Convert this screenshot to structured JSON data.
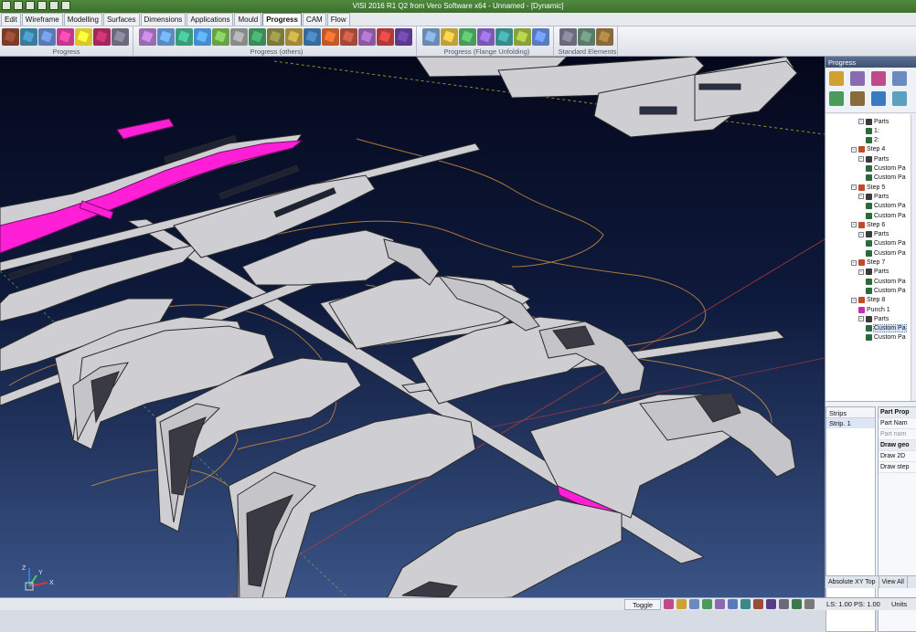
{
  "window": {
    "title": "VISI 2016 R1 Q2 from Vero Software x64 - Unnamed - [Dynamic]"
  },
  "menu": {
    "tabs": [
      "Edit",
      "Wireframe",
      "Modelling",
      "Surfaces",
      "Dimensions",
      "Applications",
      "Mould",
      "Progress",
      "CAM",
      "Flow"
    ],
    "active": "Progress"
  },
  "ribbon": {
    "groups": [
      {
        "label": "Progress",
        "colors": [
          "#7a3d2a",
          "#3a7a9a",
          "#5a7ab0",
          "#c03a8a",
          "#d8c82a",
          "#a0285a",
          "#6a6a7a"
        ]
      },
      {
        "label": "Progress (others)",
        "colors": [
          "#9a6ab0",
          "#5a8ac0",
          "#3a9a7a",
          "#4a8ad0",
          "#6aa04a",
          "#8a8a8a",
          "#3a8a5a",
          "#7a7a3a",
          "#a08a3a",
          "#3a6a9a",
          "#c05a2a",
          "#a04a3a",
          "#8a5aa0",
          "#b03a3a",
          "#5a3a8a"
        ]
      },
      {
        "label": "Progress (Flange Unfolding)",
        "colors": [
          "#6a8ab0",
          "#c0a03a",
          "#4a9a5a",
          "#7a5ab0",
          "#3a8a8a",
          "#8aa03a",
          "#5a7ac0"
        ]
      },
      {
        "label": "Standard Elements",
        "colors": [
          "#6a6a7a",
          "#5a7a6a",
          "#8a6a3a"
        ]
      }
    ]
  },
  "panel": {
    "title": "Progress",
    "tools": [
      "#d0a030",
      "#8a6ab0",
      "#c04a8a",
      "#6a8ac0",
      "#4a9a5a",
      "#8a6a3a",
      "#3a7ac0",
      "#5aa0c0"
    ],
    "tree": [
      {
        "level": 1,
        "label": "Parts",
        "icon": "parts"
      },
      {
        "level": 2,
        "label": "1:",
        "icon": "part"
      },
      {
        "level": 2,
        "label": "2:",
        "icon": "part"
      },
      {
        "level": 0,
        "label": "Step 4",
        "icon": "step"
      },
      {
        "level": 1,
        "label": "Parts",
        "icon": "parts"
      },
      {
        "level": 2,
        "label": "Custom Pa",
        "icon": "part"
      },
      {
        "level": 2,
        "label": "Custom Pa",
        "icon": "part"
      },
      {
        "level": 0,
        "label": "Step 5",
        "icon": "step"
      },
      {
        "level": 1,
        "label": "Parts",
        "icon": "parts"
      },
      {
        "level": 2,
        "label": "Custom Pa",
        "icon": "part"
      },
      {
        "level": 2,
        "label": "Custom Pa",
        "icon": "part"
      },
      {
        "level": 0,
        "label": "Step 6",
        "icon": "step"
      },
      {
        "level": 1,
        "label": "Parts",
        "icon": "parts"
      },
      {
        "level": 2,
        "label": "Custom Pa",
        "icon": "part"
      },
      {
        "level": 2,
        "label": "Custom Pa",
        "icon": "part"
      },
      {
        "level": 0,
        "label": "Step 7",
        "icon": "step"
      },
      {
        "level": 1,
        "label": "Parts",
        "icon": "parts"
      },
      {
        "level": 2,
        "label": "Custom Pa",
        "icon": "part"
      },
      {
        "level": 2,
        "label": "Custom Pa",
        "icon": "part"
      },
      {
        "level": 0,
        "label": "Step 8",
        "icon": "step"
      },
      {
        "level": 1,
        "label": "Punch 1",
        "icon": "punch"
      },
      {
        "level": 1,
        "label": "Parts",
        "icon": "parts"
      },
      {
        "level": 2,
        "label": "Custom Pa",
        "icon": "part",
        "selected": true
      },
      {
        "level": 2,
        "label": "Custom Pa",
        "icon": "part"
      }
    ],
    "strips": {
      "header": "Strips",
      "rows": [
        "Strip. 1"
      ]
    },
    "properties": [
      {
        "label": "Part Prop",
        "kind": "head"
      },
      {
        "label": "Part Nam",
        "kind": "row"
      },
      {
        "label": "Part nam",
        "kind": "grey"
      },
      {
        "label": "Draw geo",
        "kind": "head"
      },
      {
        "label": "Draw 2D",
        "kind": "row"
      },
      {
        "label": "Draw step",
        "kind": "row"
      }
    ],
    "bottom": [
      "Absolute XY Top",
      "View All"
    ]
  },
  "viewport": {
    "axis_labels": [
      "X",
      "Y",
      "Z"
    ],
    "colors": {
      "part": "#cfcfd3",
      "part_edge": "#2a2a2a",
      "highlight": "#ff1fd6",
      "contour": "#c88a3a",
      "bg_top": "#05081c",
      "bg_bottom": "#3a5486"
    }
  },
  "status": {
    "toggle": "Toggle",
    "ls": "LS: 1.00 PS: 1.00",
    "units": "Units"
  }
}
